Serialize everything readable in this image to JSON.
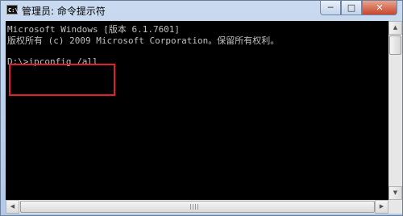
{
  "window": {
    "title": "管理员: 命令提示符",
    "icon": "cmd-icon",
    "icon_text": "C:\\",
    "controls": {
      "minimize": "─",
      "maximize": "□",
      "close": "✕"
    }
  },
  "console": {
    "lines": [
      "Microsoft Windows [版本 6.1.7601]",
      "版权所有 (c) 2009 Microsoft Corporation。保留所有权利。",
      "",
      "D:\\>ipconfig /all"
    ]
  },
  "colors": {
    "console_bg": "#000000",
    "console_text": "#c0c0c0",
    "highlight_box": "#e0202a",
    "close_button": "#c8452b"
  },
  "scrollbars": {
    "up_arrow": "▲",
    "down_arrow": "▼",
    "left_arrow": "◀",
    "right_arrow": "▶"
  }
}
